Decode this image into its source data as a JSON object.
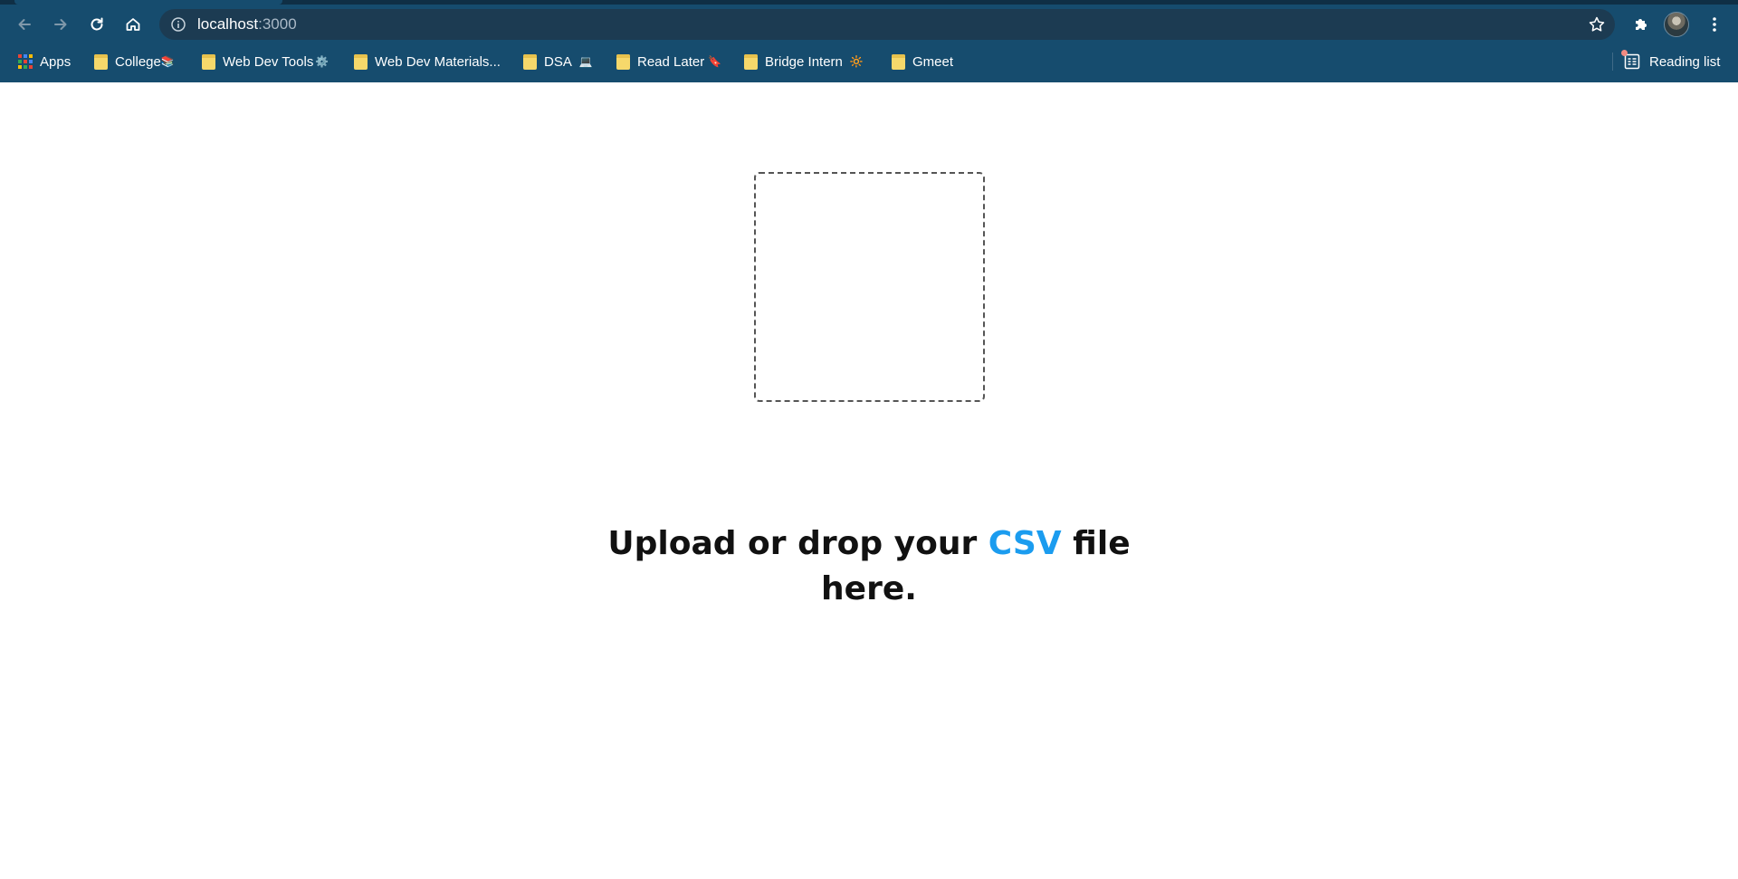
{
  "browser": {
    "url_host": "localhost",
    "url_port": ":3000",
    "bookmarks": [
      {
        "label": "Apps",
        "emoji": ""
      },
      {
        "label": "College",
        "emoji": "📚"
      },
      {
        "label": "Web Dev Tools",
        "emoji": "⚙️"
      },
      {
        "label": "Web Dev Materials...",
        "emoji": ""
      },
      {
        "label": "DSA",
        "emoji": "💻"
      },
      {
        "label": "Read Later",
        "emoji": "🔖"
      },
      {
        "label": "Bridge Intern",
        "emoji": "🔆"
      },
      {
        "label": "Gmeet",
        "emoji": ""
      }
    ],
    "reading_list_label": "Reading list",
    "colors": {
      "chrome_bg": "#164c6e",
      "omnibox_bg": "#1c3b52",
      "folder": "#f6d86b"
    }
  },
  "page": {
    "upload_text_before": "Upload or drop your ",
    "upload_text_highlight": "CSV",
    "upload_text_after": " file here.",
    "colors": {
      "highlight": "#1b9cef",
      "text": "#111111",
      "dropzone_border": "#555555"
    }
  }
}
